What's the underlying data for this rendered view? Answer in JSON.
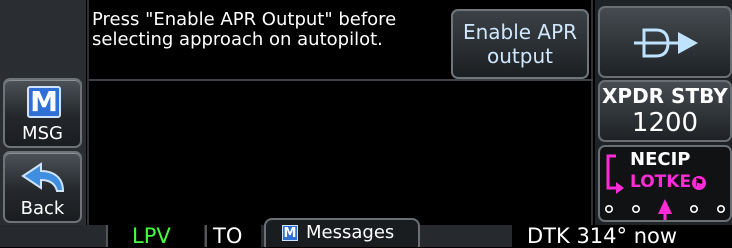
{
  "message": {
    "text_line1": "Press \"Enable APR Output\" before",
    "text_line2": "selecting approach on autopilot.",
    "enable_button": {
      "line1": "Enable APR",
      "line2": "output"
    }
  },
  "left_panel": {
    "msg_button": {
      "glyph": "M",
      "label": "MSG"
    },
    "back_button": {
      "label": "Back"
    }
  },
  "right_panel": {
    "direct_to_icon": "direct-to-icon",
    "xpdr": {
      "mode": "XPDR STBY",
      "code": "1200"
    },
    "flight_plan": {
      "from": "NECIP",
      "to": "LOTKE"
    }
  },
  "status_bar": {
    "approach_mode": "LPV",
    "to_from": "TO",
    "messages_tab": {
      "icon_letter": "M",
      "label": "Messages"
    },
    "dtk": "DTK 314° now"
  },
  "colors": {
    "green": "#44ff3a",
    "magenta": "#ff2bd6",
    "cyan_text": "#cfe7ff",
    "direct_to_icon": "#bfe3ff",
    "msg_icon_bg": "#2f6fd6"
  }
}
